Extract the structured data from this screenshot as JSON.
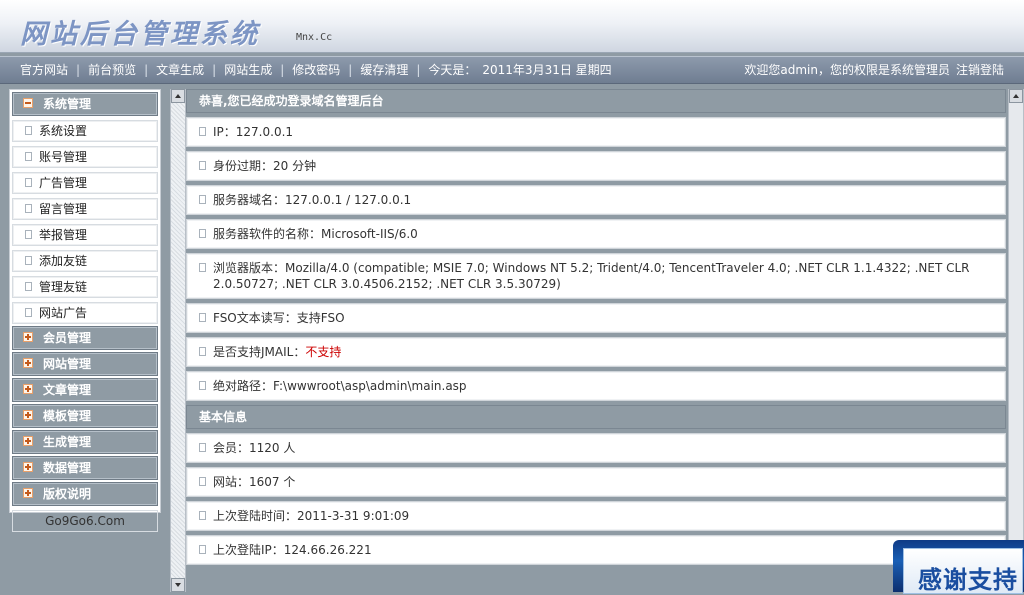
{
  "header": {
    "logo_text": "网站后台管理系统",
    "logo_sub": "Mnx.Cc"
  },
  "topnav": {
    "items": [
      "官方网站",
      "前台预览",
      "文章生成",
      "网站生成",
      "修改密码",
      "缓存清理"
    ],
    "date_label": "今天是：",
    "date_value": "2011年3月31日 星期四",
    "welcome": "欢迎您admin，您的权限是系统管理员",
    "logout": "注销登陆"
  },
  "sidebar": {
    "system": {
      "label": "系统管理",
      "items": [
        "系统设置",
        "账号管理",
        "广告管理",
        "留言管理",
        "举报管理",
        "添加友链",
        "管理友链",
        "网站广告"
      ]
    },
    "categories": [
      "会员管理",
      "网站管理",
      "文章管理",
      "模板管理",
      "生成管理",
      "数据管理",
      "版权说明"
    ],
    "footer_link": "Go9Go6.Com"
  },
  "main": {
    "welcome_title": "恭喜,您已经成功登录域名管理后台",
    "info": {
      "ip_label": "IP：",
      "ip_value": "127.0.0.1",
      "expire_label": "身份过期：",
      "expire_value": "20 分钟",
      "domain_label": "服务器域名：",
      "domain_value": "127.0.0.1 / 127.0.0.1",
      "software_label": "服务器软件的名称：",
      "software_value": "Microsoft-IIS/6.0",
      "browser_label": "浏览器版本：",
      "browser_value": "Mozilla/4.0 (compatible; MSIE 7.0; Windows NT 5.2; Trident/4.0; TencentTraveler 4.0; .NET CLR 1.1.4322; .NET CLR 2.0.50727; .NET CLR 3.0.4506.2152; .NET CLR 3.5.30729)",
      "fso_label": "FSO文本读写：",
      "fso_value": "支持FSO",
      "jmail_label": "是否支持JMAIL：",
      "jmail_value": "不支持",
      "path_label": "绝对路径：",
      "path_value": "F:\\wwwroot\\asp\\admin\\main.asp"
    },
    "basic_title": "基本信息",
    "basic": {
      "members_label": "会员：",
      "members_value": "1120 人",
      "sites_label": "网站：",
      "sites_value": "1607 个",
      "last_time_label": "上次登陆时间：",
      "last_time_value": "2011-3-31 9:01:09",
      "last_ip_label": "上次登陆IP：",
      "last_ip_value": "124.66.26.221"
    }
  },
  "badge": {
    "text": "感谢支持"
  },
  "colors": {
    "panel": "#8f9ba4",
    "nav": "#7f8c9f",
    "warning": "#cc0000",
    "logo": "#7d95c4"
  }
}
